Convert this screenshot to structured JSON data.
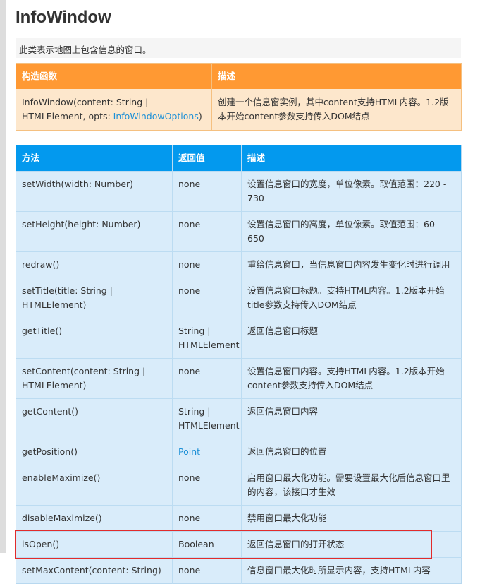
{
  "title": "InfoWindow",
  "description": "此类表示地图上包含信息的窗口。",
  "constructor_table": {
    "headers": [
      "构造函数",
      "描述"
    ],
    "row": {
      "signature_prefix": "InfoWindow(content: String | HTMLElement, opts: ",
      "signature_link": "InfoWindowOptions",
      "signature_suffix": ")",
      "description": "创建一个信息窗实例，其中content支持HTML内容。1.2版本开始content参数支持传入DOM结点"
    }
  },
  "methods_table": {
    "headers": [
      "方法",
      "返回值",
      "描述"
    ],
    "rows": [
      {
        "method": "setWidth(width: Number)",
        "returns": "none",
        "desc": "设置信息窗口的宽度，单位像素。取值范围：220 - 730"
      },
      {
        "method": "setHeight(height: Number)",
        "returns": "none",
        "desc": "设置信息窗口的高度，单位像素。取值范围：60 - 650"
      },
      {
        "method": "redraw()",
        "returns": "none",
        "desc": "重绘信息窗口，当信息窗口内容发生变化时进行调用"
      },
      {
        "method": "setTitle(title: String | HTMLElement)",
        "returns": "none",
        "desc": "设置信息窗口标题。支持HTML内容。1.2版本开始title参数支持传入DOM结点"
      },
      {
        "method": "getTitle()",
        "returns": "String | HTMLElement",
        "desc": "返回信息窗口标题"
      },
      {
        "method": "setContent(content: String | HTMLElement)",
        "returns": "none",
        "desc": "设置信息窗口内容。支持HTML内容。1.2版本开始content参数支持传入DOM结点"
      },
      {
        "method": "getContent()",
        "returns": "String | HTMLElement",
        "desc": "返回信息窗口内容"
      },
      {
        "method": "getPosition()",
        "returns": "Point",
        "returns_is_link": true,
        "desc": "返回信息窗口的位置"
      },
      {
        "method": "enableMaximize()",
        "returns": "none",
        "desc": "启用窗口最大化功能。需要设置最大化后信息窗口里的内容，该接口才生效"
      },
      {
        "method": "disableMaximize()",
        "returns": "none",
        "desc": "禁用窗口最大化功能"
      },
      {
        "method": "isOpen()",
        "returns": "Boolean",
        "desc": "返回信息窗口的打开状态",
        "highlighted": true
      },
      {
        "method": "setMaxContent(content: String)",
        "returns": "none",
        "desc": "信息窗口最大化时所显示内容，支持HTML内容"
      }
    ]
  },
  "colors": {
    "constructor_header": "#ff9933",
    "constructor_row": "#fde7cc",
    "methods_header": "#0399ee",
    "methods_row": "#d9ecfa",
    "link": "#1e90d6",
    "highlight_border": "#e22b2b"
  }
}
